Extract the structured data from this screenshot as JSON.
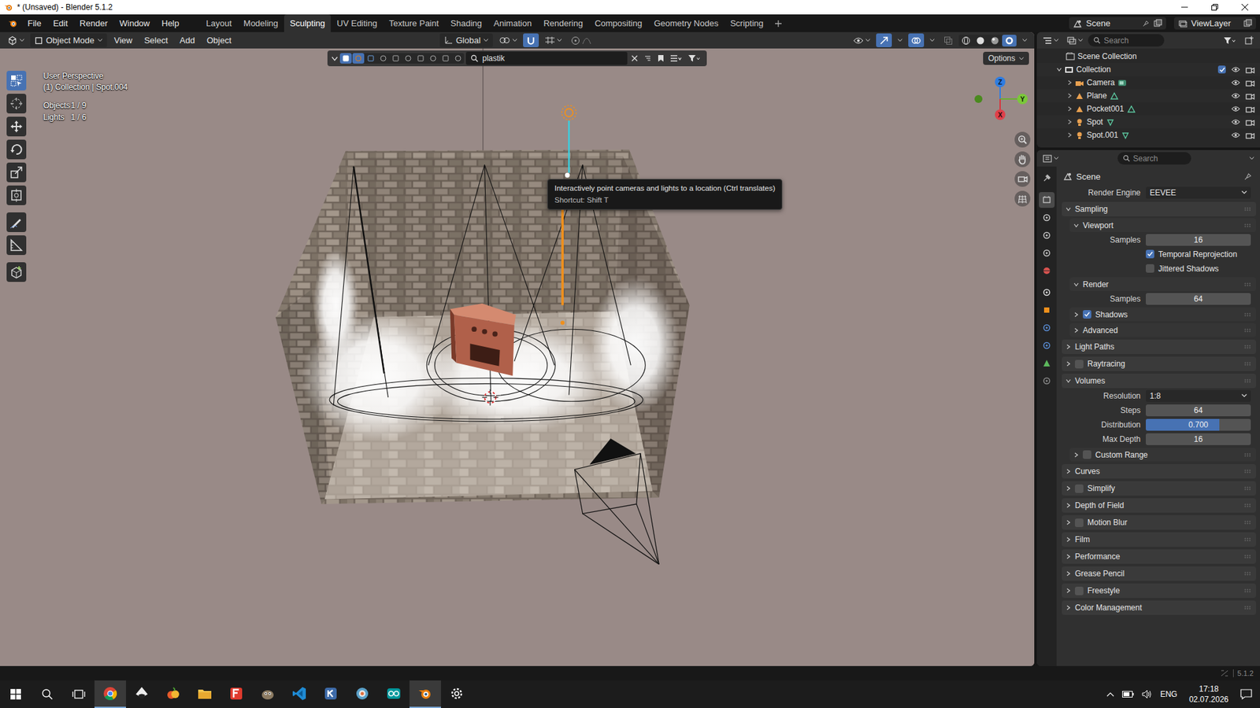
{
  "window": {
    "title": "* (Unsaved) - Blender 5.1.2"
  },
  "menu": [
    "File",
    "Edit",
    "Render",
    "Window",
    "Help"
  ],
  "workspaces": [
    {
      "label": "Layout",
      "selected": false
    },
    {
      "label": "Modeling",
      "selected": false
    },
    {
      "label": "Sculpting",
      "selected": true
    },
    {
      "label": "UV Editing",
      "selected": false
    },
    {
      "label": "Texture Paint",
      "selected": false
    },
    {
      "label": "Shading",
      "selected": false
    },
    {
      "label": "Animation",
      "selected": false
    },
    {
      "label": "Rendering",
      "selected": false
    },
    {
      "label": "Compositing",
      "selected": false
    },
    {
      "label": "Geometry Nodes",
      "selected": false
    },
    {
      "label": "Scripting",
      "selected": false
    }
  ],
  "scene_selector": {
    "scene": "Scene",
    "view_layer": "ViewLayer"
  },
  "viewport": {
    "mode": "Object Mode",
    "menus": [
      "View",
      "Select",
      "Add",
      "Object"
    ],
    "orientation": "Global",
    "search": "plastik",
    "options_label": "Options",
    "info": [
      "User Perspective",
      "(1) Collection | Spot.004"
    ],
    "stats": [
      {
        "label": "Objects",
        "value": "1 / 9"
      },
      {
        "label": "Lights",
        "value": "1 / 6"
      }
    ],
    "tools": [
      {
        "selected": true
      },
      {
        "selected": false
      },
      {
        "selected": false
      },
      {
        "selected": false
      },
      {
        "selected": false
      },
      {
        "selected": false
      },
      {
        "selected": false
      },
      {
        "selected": false
      },
      {
        "selected": false
      }
    ],
    "shading": [
      {
        "selected": false
      },
      {
        "selected": false
      },
      {
        "selected": false
      },
      {
        "selected": true
      }
    ],
    "gizmo": {
      "z": "Z",
      "y": "Y",
      "x": "X"
    },
    "tooltip": {
      "text": "Interactively point cameras and lights to a location (Ctrl translates)",
      "shortcut": "Shortcut: Shift T"
    }
  },
  "outliner": {
    "search_placeholder": "Search",
    "root": "Scene Collection",
    "collection": {
      "name": "Collection",
      "expanded": true,
      "included": true
    },
    "items": [
      {
        "name": "Camera",
        "kind": "camera",
        "visible": true
      },
      {
        "name": "Plane",
        "kind": "mesh",
        "visible": true
      },
      {
        "name": "Pocket001",
        "kind": "mesh",
        "visible": true
      },
      {
        "name": "Spot",
        "kind": "light",
        "visible": true
      },
      {
        "name": "Spot.001",
        "kind": "light",
        "visible": true
      }
    ]
  },
  "properties": {
    "search_placeholder": "Search",
    "context": "Scene",
    "tabs": [
      {
        "selected": false
      },
      {
        "selected": true
      },
      {
        "selected": false
      },
      {
        "selected": false
      },
      {
        "selected": false
      },
      {
        "selected": false
      },
      {
        "selected": false
      },
      {
        "selected": false
      },
      {
        "selected": false
      },
      {
        "selected": false
      },
      {
        "selected": false
      },
      {
        "selected": false
      }
    ],
    "rows": [
      {
        "kind": "dropdown",
        "label": "Render Engine",
        "value": "EEVEE"
      },
      {
        "kind": "panel",
        "label": "Sampling",
        "expanded": true,
        "checkbox": false,
        "checked": false
      },
      {
        "kind": "subpanel",
        "label": "Viewport",
        "expanded": true,
        "checkbox": false,
        "checked": false
      },
      {
        "kind": "number",
        "label": "Samples",
        "value": "16"
      },
      {
        "kind": "check",
        "label": "Temporal Reprojection",
        "checked": true
      },
      {
        "kind": "check",
        "label": "Jittered Shadows",
        "checked": false
      },
      {
        "kind": "subpanel",
        "label": "Render",
        "expanded": true,
        "checkbox": false,
        "checked": false
      },
      {
        "kind": "number",
        "label": "Samples",
        "value": "64"
      },
      {
        "kind": "subpanel",
        "label": "Shadows",
        "expanded": false,
        "checkbox": true,
        "checked": true
      },
      {
        "kind": "subpanel",
        "label": "Advanced",
        "expanded": false,
        "checkbox": false,
        "checked": false
      },
      {
        "kind": "panel",
        "label": "Light Paths",
        "expanded": false,
        "checkbox": false,
        "checked": false
      },
      {
        "kind": "panel",
        "label": "Raytracing",
        "expanded": false,
        "checkbox": true,
        "checked": false
      },
      {
        "kind": "panel",
        "label": "Volumes",
        "expanded": true,
        "checkbox": false,
        "checked": false
      },
      {
        "kind": "dropdown",
        "label": "Resolution",
        "value": "1:8"
      },
      {
        "kind": "number",
        "label": "Steps",
        "value": "64"
      },
      {
        "kind": "slider",
        "label": "Distribution",
        "value": "0.700",
        "level": 0.7
      },
      {
        "kind": "number",
        "label": "Max Depth",
        "value": "16"
      },
      {
        "kind": "subpanel",
        "label": "Custom Range",
        "expanded": false,
        "checkbox": true,
        "checked": false
      },
      {
        "kind": "panel",
        "label": "Curves",
        "expanded": false,
        "checkbox": false,
        "checked": false
      },
      {
        "kind": "panel",
        "label": "Simplify",
        "expanded": false,
        "checkbox": true,
        "checked": false
      },
      {
        "kind": "panel",
        "label": "Depth of Field",
        "expanded": false,
        "checkbox": false,
        "checked": false
      },
      {
        "kind": "panel",
        "label": "Motion Blur",
        "expanded": false,
        "checkbox": true,
        "checked": false
      },
      {
        "kind": "panel",
        "label": "Film",
        "expanded": false,
        "checkbox": false,
        "checked": false
      },
      {
        "kind": "panel",
        "label": "Performance",
        "expanded": false,
        "checkbox": false,
        "checked": false
      },
      {
        "kind": "panel",
        "label": "Grease Pencil",
        "expanded": false,
        "checkbox": false,
        "checked": false
      },
      {
        "kind": "panel",
        "label": "Freestyle",
        "expanded": false,
        "checkbox": true,
        "checked": false
      },
      {
        "kind": "panel",
        "label": "Color Management",
        "expanded": false,
        "checkbox": false,
        "checked": false
      }
    ]
  },
  "status_bar": {
    "version": "5.1.2"
  },
  "taskbar": {
    "apps": [
      {
        "running": true,
        "selected": true
      },
      {
        "running": false,
        "selected": false
      },
      {
        "running": false,
        "selected": false
      },
      {
        "running": false,
        "selected": false
      },
      {
        "running": false,
        "selected": false
      },
      {
        "running": false,
        "selected": false
      },
      {
        "running": false,
        "selected": false
      },
      {
        "running": false,
        "selected": false
      },
      {
        "running": false,
        "selected": false
      },
      {
        "running": false,
        "selected": false
      },
      {
        "running": true,
        "selected": true
      },
      {
        "running": false,
        "selected": false
      }
    ],
    "language": "ENG",
    "time": "17:18",
    "date": "02.07.2026"
  }
}
